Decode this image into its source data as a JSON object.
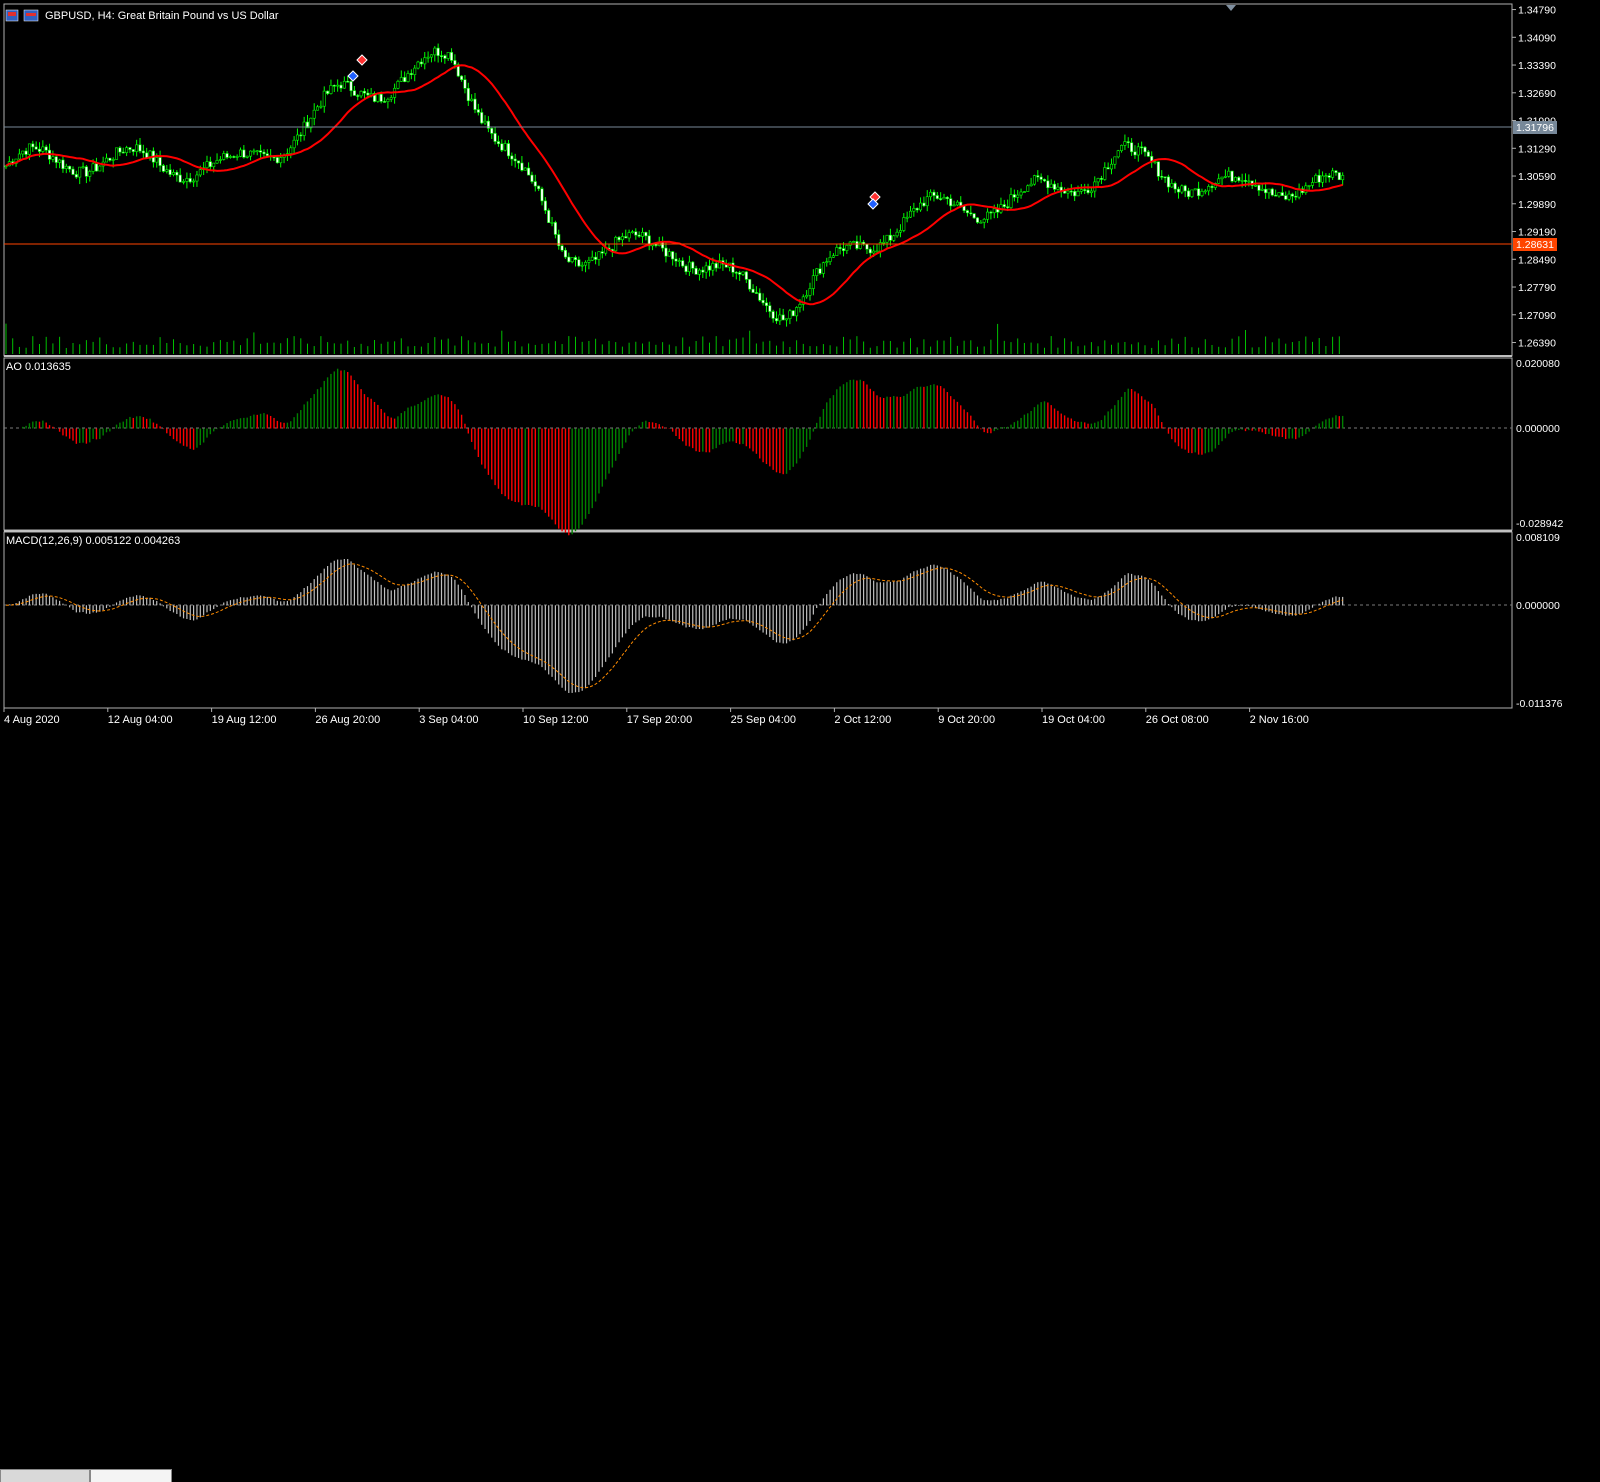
{
  "chart_header": {
    "symbol_title": "GBPUSD, H4:  Great Britain Pound vs US Dollar"
  },
  "price_pane": {
    "y_ticks": [
      "1.34790",
      "1.34090",
      "1.33390",
      "1.32690",
      "1.31990",
      "1.31290",
      "1.30590",
      "1.29890",
      "1.29190",
      "1.28490",
      "1.27790",
      "1.27090",
      "1.26390"
    ],
    "ask_line_label": "1.31796",
    "bid_line_label": "1.28631"
  },
  "ao_pane": {
    "label": "AO 0.013635",
    "y_ticks": [
      "0.020080",
      "0.000000",
      "-0.028942"
    ]
  },
  "macd_pane": {
    "label": "MACD(12,26,9) 0.005122 0.004263",
    "y_ticks": [
      "0.008109",
      "0.000000",
      "-0.011376"
    ]
  },
  "x_axis": {
    "labels": [
      "4 Aug 2020",
      "12 Aug 04:00",
      "19 Aug 12:00",
      "26 Aug 20:00",
      "3 Sep 04:00",
      "10 Sep 12:00",
      "17 Sep 20:00",
      "25 Sep 04:00",
      "2 Oct 12:00",
      "9 Oct 20:00",
      "19 Oct 04:00",
      "26 Oct 08:00",
      "2 Nov 16:00"
    ]
  },
  "colors": {
    "bull": "#00ff00",
    "ma": "#ff0000",
    "ao_up": "#008000",
    "ao_down": "#ff0000",
    "macd_hist": "#c0c0c0",
    "macd_signal": "#ff8c00",
    "ask_line": "#778899",
    "bid_line": "#ff4500"
  },
  "chart_data": {
    "type": "line",
    "symbol": "GBPUSD",
    "timeframe": "H4",
    "price_ylim": [
      1.2605,
      1.3493
    ],
    "price_close_keypoints": {
      "x": [
        "4 Aug 2020",
        "12 Aug 04:00",
        "19 Aug 12:00",
        "26 Aug 20:00",
        "3 Sep 04:00",
        "10 Sep 12:00",
        "17 Sep 20:00",
        "25 Sep 04:00",
        "2 Oct 12:00",
        "9 Oct 20:00",
        "19 Oct 04:00",
        "26 Oct 08:00",
        "2 Nov 16:00"
      ],
      "y": [
        1.3085,
        1.305,
        1.309,
        1.33,
        1.332,
        1.284,
        1.293,
        1.274,
        1.29,
        1.3,
        1.315,
        1.3,
        1.299
      ]
    },
    "series": [
      {
        "name": "AO",
        "last": 0.013635
      },
      {
        "name": "MACD(12,26,9)",
        "main": 0.005122,
        "signal": 0.004263
      }
    ],
    "ao_ylim": [
      -0.028942,
      0.02008
    ],
    "macd_ylim": [
      -0.011376,
      0.008109
    ]
  }
}
